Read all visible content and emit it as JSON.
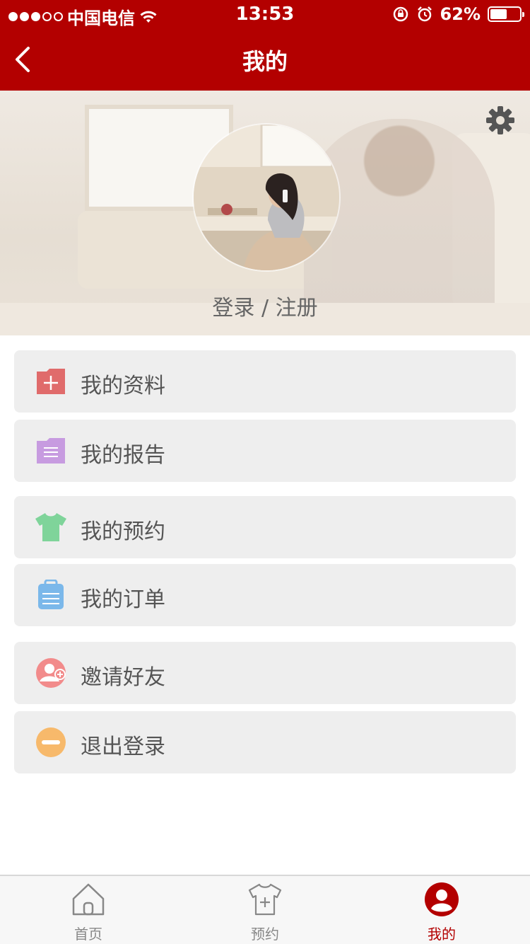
{
  "status_bar": {
    "carrier": "中国电信",
    "time": "13:53",
    "battery_percent": "62%",
    "battery_level": 0.62,
    "icons": [
      "signal-dots-icon",
      "wifi-icon",
      "rotation-lock-icon",
      "alarm-icon",
      "battery-icon"
    ]
  },
  "nav": {
    "title": "我的",
    "back_icon": "chevron-left-icon"
  },
  "profile": {
    "login_text": "登录 / 注册",
    "settings_icon": "gear-icon"
  },
  "menu": [
    {
      "label": "我的资料",
      "icon": "folder-plus-icon",
      "color": "#e06b6b"
    },
    {
      "label": "我的报告",
      "icon": "folder-list-icon",
      "color": "#c79be0"
    },
    {
      "label": "我的预约",
      "icon": "shirt-icon",
      "color": "#7fd49a"
    },
    {
      "label": "我的订单",
      "icon": "clipboard-list-icon",
      "color": "#7bb8ea"
    },
    {
      "label": "邀请好友",
      "icon": "add-user-icon",
      "color": "#f28b8b"
    },
    {
      "label": "退出登录",
      "icon": "minus-circle-icon",
      "color": "#f7b96b"
    }
  ],
  "tabbar": {
    "tabs": [
      {
        "label": "首页",
        "icon": "home-icon",
        "active": false
      },
      {
        "label": "预约",
        "icon": "shirt-plus-icon",
        "active": false
      },
      {
        "label": "我的",
        "icon": "user-circle-icon",
        "active": true
      }
    ]
  },
  "colors": {
    "brand_red": "#b30000",
    "menu_bg": "#eeeeee",
    "tab_inactive": "#888888"
  }
}
